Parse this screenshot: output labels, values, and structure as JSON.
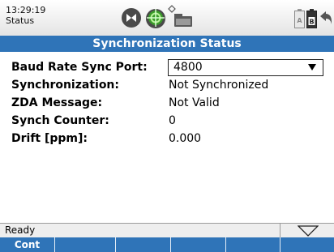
{
  "statusbar": {
    "time": "13:29:19",
    "mode": "Status",
    "icons": [
      "radio-mute-icon",
      "gps-target-icon",
      "signal-indicator-icon",
      "sd-card-icon",
      "battery-a-icon",
      "battery-b-icon",
      "back-arrow-icon"
    ],
    "colors": {
      "gps_green": "#3a9a2a",
      "gps_ring": "#6ccf4a",
      "icon_grey": "#555555"
    }
  },
  "title": "Synchronization Status",
  "fields": {
    "baud": {
      "label": "Baud Rate Sync Port:",
      "value": "4800"
    },
    "sync": {
      "label": "Synchronization:",
      "value": "Not Synchronized"
    },
    "zda": {
      "label": "ZDA Message:",
      "value": "Not Valid"
    },
    "counter": {
      "label": "Synch Counter:",
      "value": "0"
    },
    "drift": {
      "label": "Drift [ppm]:",
      "value": "0.000"
    }
  },
  "footer": {
    "status": "Ready",
    "menu_icon": "triangle-down-icon"
  },
  "softkeys": [
    "Cont",
    "",
    "",
    "",
    "",
    ""
  ],
  "colors": {
    "accent": "#2f74b8",
    "text": "#000000",
    "background": "#ffffff"
  }
}
